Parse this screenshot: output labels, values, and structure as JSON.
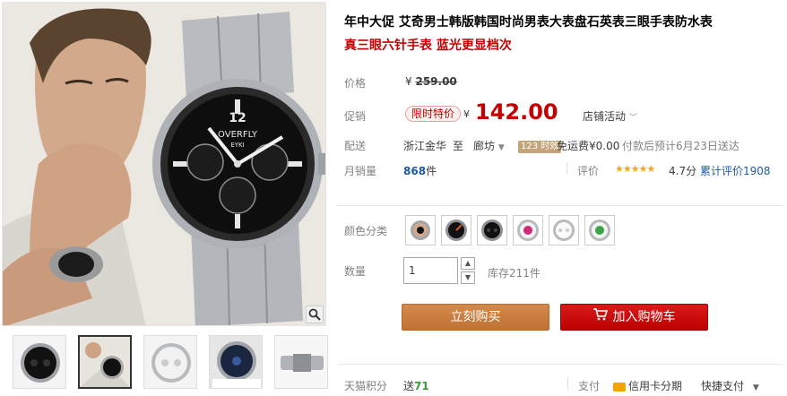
{
  "product": {
    "title": "年中大促 艾奇男士韩版韩国时尚男表大表盘石英表三眼手表防水表",
    "subtitle": "真三眼六针手表 蓝光更显档次"
  },
  "price": {
    "label": "价格",
    "original_yen": "¥",
    "original": "259.00",
    "promo_label": "促销",
    "promo_tag": "限时特价",
    "current_yen": "¥",
    "current": "142.00",
    "shop_activity": "店铺活动"
  },
  "delivery": {
    "label": "配送",
    "from": "浙江金华",
    "to_word": "至",
    "to": "廊坊",
    "badge": "123 时效",
    "free_shipping": "免运费¥0.00",
    "eta": "付款后预计6月23日送达"
  },
  "sales": {
    "label": "月销量",
    "count": "868",
    "unit": "件",
    "rating_label": "评价",
    "stars": "★★★★★",
    "score": "4.7分",
    "reviews": "累计评价1908"
  },
  "sku": {
    "color_label": "颜色分类"
  },
  "quantity": {
    "label": "数量",
    "value": "1",
    "stock": "库存211件"
  },
  "actions": {
    "buy_now": "立刻购买",
    "add_cart": "加入购物车"
  },
  "footer": {
    "points_label": "天猫积分",
    "points_prefix": "送",
    "points": "71",
    "pay_label": "支付",
    "credit": "信用卡分期",
    "quick_pay": "快捷支付"
  },
  "watch": {
    "brand": "OVERFLY",
    "sub_brand": "EYKI",
    "number": "12"
  },
  "colors": {
    "price_red": "#c40000",
    "buy_button": "#c67b3b",
    "cart_button": "#c40000",
    "star": "#f5a623",
    "link": "#1c5aa9"
  }
}
